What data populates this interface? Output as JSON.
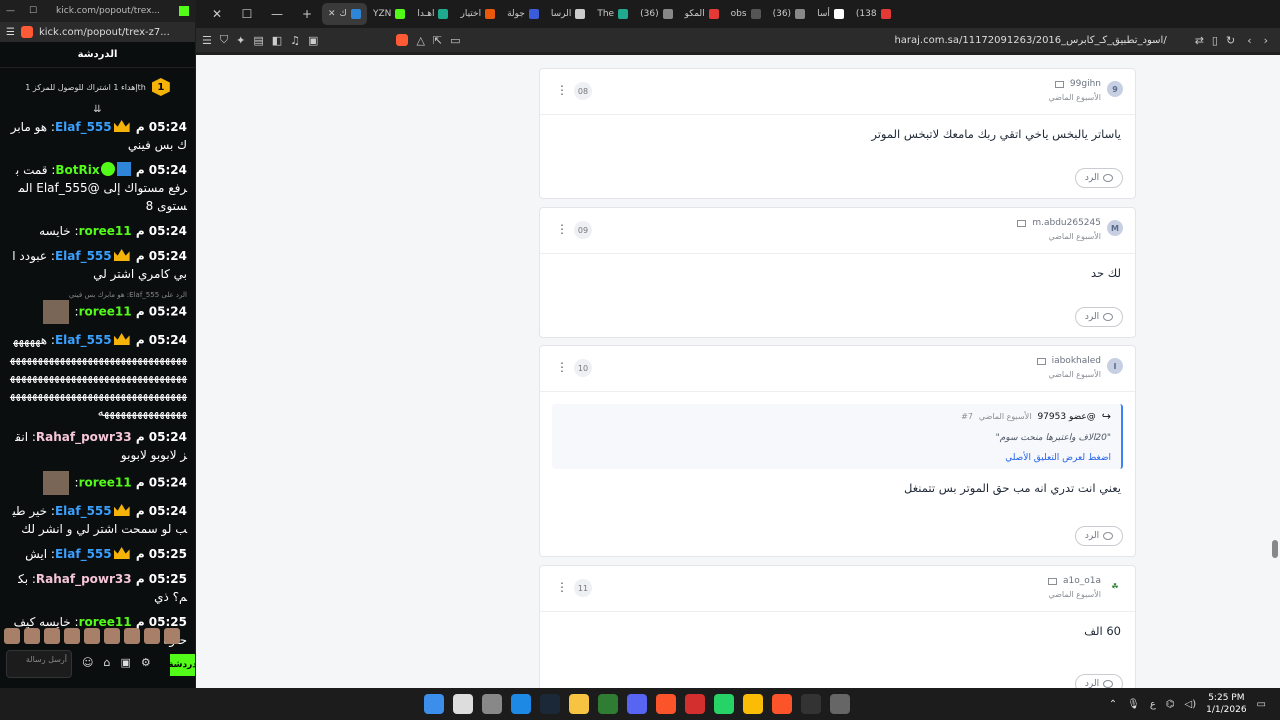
{
  "left_window": {
    "top_tab": "kick.com/popout/trex...",
    "url": "kick.com/popout/trex-z7...",
    "chat_title": "الدردشة",
    "goal_number": "1",
    "goal_text": "إهداء 1 اشتراك للوصول للمركز 1th",
    "messages": [
      {
        "time": "05:24",
        "user": "Elaf_555",
        "text": "هو مابرك بس فيني",
        "user_color": "#3aa0ff",
        "badge": "crown"
      },
      {
        "time": "05:24",
        "user": "BotRix",
        "text": "قمت برفع مستواك إلى @Elaf_555 المستوى 8",
        "user_color": "#53fc18",
        "badge": "bot"
      },
      {
        "time": "05:24",
        "user": "roree11",
        "text": "خايسه",
        "user_color": "#53fc18",
        "badge": ""
      },
      {
        "time": "05:24",
        "user": "Elaf_555",
        "text": "عبودد ابي كامري اشتر لي",
        "user_color": "#3aa0ff",
        "badge": "crown"
      },
      {
        "time": "05:24",
        "user": "roree11",
        "text": "",
        "user_color": "#53fc18",
        "badge": "avatar",
        "reply_hint": "الرد على Elaf_555: هو مابرك بس فيني"
      },
      {
        "time": "05:24",
        "user": "Elaf_555",
        "text": "هههههههههههههههههههههههههههههههههههههههههههههههههههههههههههههههههههههههههههههههههههههههههههههههههههههههههههههههههههههه",
        "user_color": "#3aa0ff",
        "badge": "crown"
      },
      {
        "time": "05:24",
        "user": "Rahaf_powr33",
        "text": "انقز لابوبو لابوبو",
        "user_color": "#f5c6d6",
        "badge": ""
      },
      {
        "time": "05:24",
        "user": "roree11",
        "text": "",
        "user_color": "#53fc18",
        "badge": "avatar"
      },
      {
        "time": "05:24",
        "user": "Elaf_555",
        "text": "خير طيب لو سمحت اشتر لي و انشر لك",
        "user_color": "#3aa0ff",
        "badge": "crown"
      },
      {
        "time": "05:25",
        "user": "Elaf_555",
        "text": "ايش",
        "user_color": "#3aa0ff",
        "badge": "crown"
      },
      {
        "time": "05:25",
        "user": "Rahaf_powr33",
        "text": "بكم؟ ذي",
        "user_color": "#f5c6d6",
        "badge": ""
      },
      {
        "time": "05:25",
        "user": "roree11",
        "text": "خايسه كيف حلوه",
        "user_color": "#53fc18",
        "badge": ""
      }
    ],
    "input_placeholder": "أرسل رسالة",
    "send_label": "دردشة",
    "time_suffix": "م"
  },
  "browser": {
    "tabs": [
      {
        "label": "(138",
        "color": "#e53935"
      },
      {
        "label": "أسا",
        "color": "#ffffff"
      },
      {
        "label": "(36)",
        "color": "#888888"
      },
      {
        "label": "obs",
        "color": "#555555"
      },
      {
        "label": "المكو",
        "color": "#e53935"
      },
      {
        "label": "(36)",
        "color": "#888888"
      },
      {
        "label": "The",
        "color": "#1faa8f"
      },
      {
        "label": "الرسا",
        "color": "#cccccc"
      },
      {
        "label": "جولة",
        "color": "#3b5bdb"
      },
      {
        "label": "اختيار",
        "color": "#e8590c"
      },
      {
        "label": "اهـدا",
        "color": "#1faa8f"
      },
      {
        "label": "YZN",
        "color": "#53fc18"
      }
    ],
    "active_tab": "ك",
    "address": "haraj.com.sa/11172091263/اسود_تطبيق_كـ_كابرس_2016/"
  },
  "comments": [
    {
      "index": "08",
      "user": "99gihn",
      "avatar": "9",
      "when": "الأسبوع الماضي",
      "text": "ياساتر يالبخس ياخي اتقي ربك مامعك لاتبخس الموتر",
      "reply": "الرد"
    },
    {
      "index": "09",
      "user": "m.abdu265245",
      "avatar": "M",
      "when": "الأسبوع الماضي",
      "text": "لك حد",
      "reply": "الرد"
    },
    {
      "index": "10",
      "user": "iabokhaled",
      "avatar": "I",
      "when": "الأسبوع الماضي",
      "text": "يعني انت تدري انه مب حق الموتر بس تتمنغل",
      "reply": "الرد",
      "quote": {
        "author": "@عضو 97953",
        "when": "الأسبوع الماضي",
        "ref": "#7",
        "text": "\"20الاف واعتبرها منحت سوم\"",
        "link": "اضغط لعرض التعليق الأصلي"
      }
    },
    {
      "index": "11",
      "user": "a1o_o1a",
      "avatar": "",
      "when": "الأسبوع الماضي",
      "text": "60 الف",
      "reply": "الرد"
    }
  ],
  "taskbar": {
    "lang": "ع",
    "time": "5:25 PM",
    "date": "1/1/2026",
    "icons": [
      "windows-icon",
      "search-icon",
      "file-explorer-icon",
      "edge-icon",
      "steam-icon",
      "folder-icon",
      "xbox-icon",
      "discord-icon",
      "brave-icon",
      "video-app-icon",
      "whatsapp-icon",
      "chrome-icon",
      "brave-active-icon",
      "epic-icon",
      "app-icon"
    ]
  }
}
